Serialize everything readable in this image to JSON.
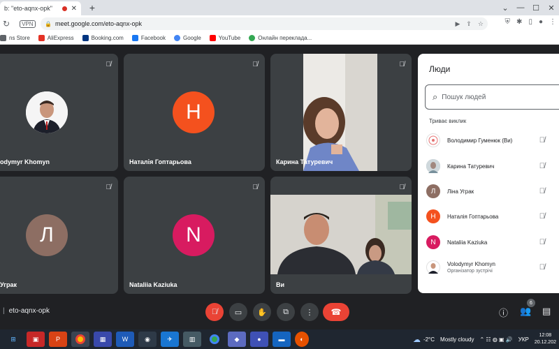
{
  "browser": {
    "tab_title": "b: \"eto-aqnx-opk\"",
    "new_tab": "+",
    "url": "meet.google.com/eto-aqnx-opk",
    "vpn_label": "VPN",
    "bookmarks": [
      {
        "label": "ns Store",
        "color": "#5f6368"
      },
      {
        "label": "AliExpress",
        "color": "#e43225"
      },
      {
        "label": "Booking.com",
        "color": "#003580"
      },
      {
        "label": "Facebook",
        "color": "#1877f2"
      },
      {
        "label": "Google",
        "color": "#4285f4"
      },
      {
        "label": "YouTube",
        "color": "#ff0000"
      },
      {
        "label": "Онлайн перекладa...",
        "color": "#34a853"
      }
    ]
  },
  "tiles": [
    {
      "name": "odymyr Khomyn",
      "type": "photo"
    },
    {
      "name": "Наталія Гоптарьова",
      "type": "letter",
      "letter": "Н",
      "color": "#f4511e"
    },
    {
      "name": "Карина Татуревич",
      "type": "video"
    },
    {
      "name": "Уграк",
      "type": "letter",
      "letter": "Л",
      "color": "#8d6e63"
    },
    {
      "name": "Nataliia Kaziuka",
      "type": "letter",
      "letter": "N",
      "color": "#d81b60"
    },
    {
      "name": "Ви",
      "type": "video"
    }
  ],
  "people_panel": {
    "title": "Люди",
    "search_placeholder": "Пошук людей",
    "section": "Триває виклик",
    "people": [
      {
        "name": "Володимир Гуменюк (Ви)",
        "sub": "",
        "avatar": "",
        "color": "#ffffff"
      },
      {
        "name": "Карина Татуревич",
        "sub": "",
        "avatar": "",
        "color": "#90a4ae"
      },
      {
        "name": "Ліна Уграк",
        "sub": "",
        "avatar": "Л",
        "color": "#8d6e63"
      },
      {
        "name": "Наталія Гоптарьова",
        "sub": "",
        "avatar": "Н",
        "color": "#f4511e"
      },
      {
        "name": "Nataliia Kaziuka",
        "sub": "",
        "avatar": "N",
        "color": "#d81b60"
      },
      {
        "name": "Volodymyr Khomyn",
        "sub": "Організатор зустрічі",
        "avatar": "",
        "color": "#ffffff"
      }
    ]
  },
  "controls": {
    "meeting_code": "eto-aqnx-opk",
    "people_count": "6"
  },
  "taskbar": {
    "temperature": "-2°C",
    "weather": "Mostly cloudy",
    "language": "УКР",
    "time": "12:08",
    "date": "20.12.202"
  }
}
